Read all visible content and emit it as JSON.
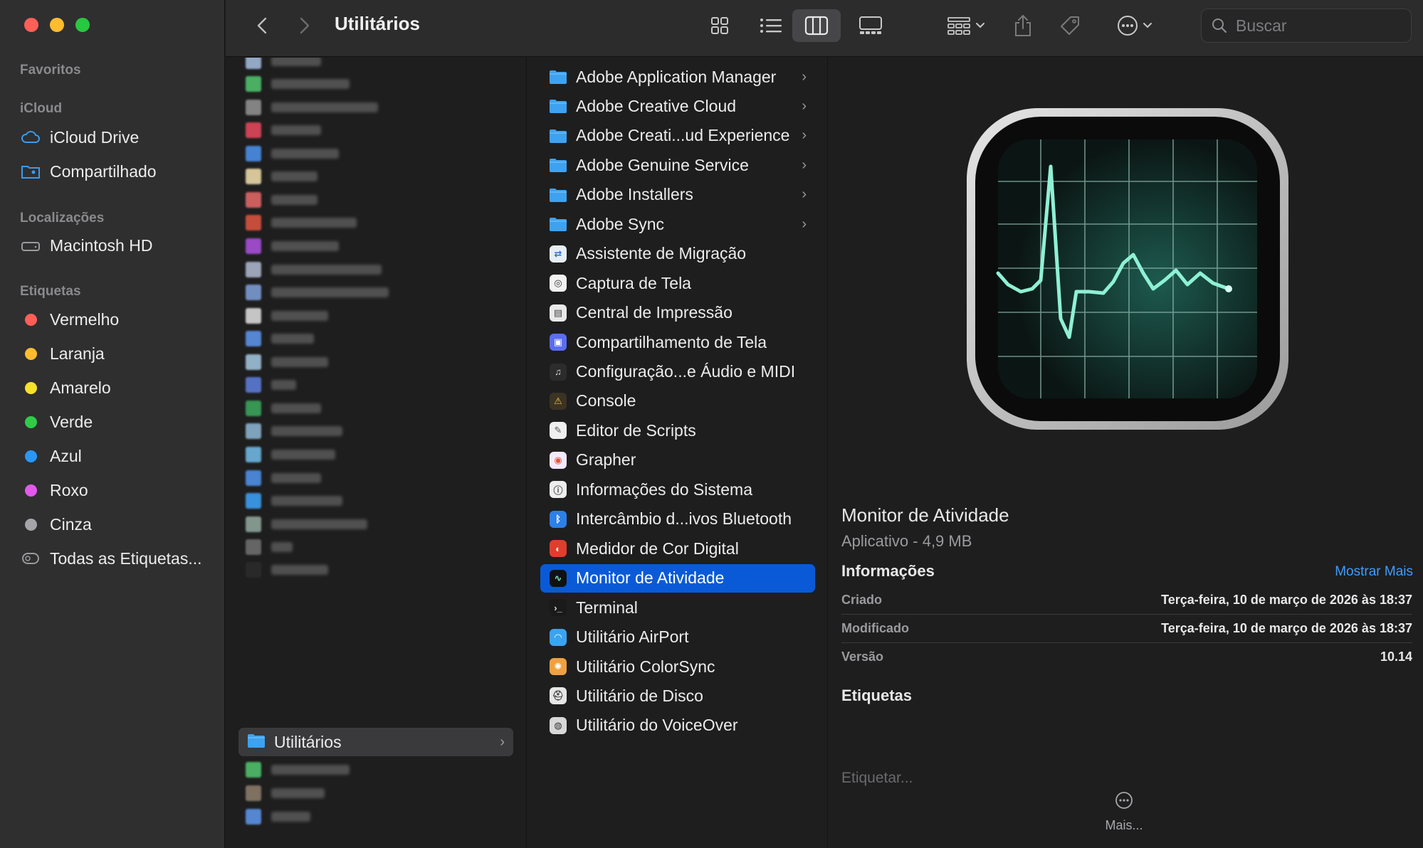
{
  "window": {
    "title": "Utilitários"
  },
  "sidebar": {
    "favorites_label": "Favoritos",
    "icloud_label": "iCloud",
    "icloud_items": [
      {
        "label": "iCloud Drive",
        "icon": "cloud-icon"
      },
      {
        "label": "Compartilhado",
        "icon": "shared-folder-icon"
      }
    ],
    "locations_label": "Localizações",
    "locations_items": [
      {
        "label": "Macintosh HD",
        "icon": "hard-drive-icon"
      }
    ],
    "tags_label": "Etiquetas",
    "tags": [
      {
        "label": "Vermelho",
        "color": "#ff5f57"
      },
      {
        "label": "Laranja",
        "color": "#febc2e"
      },
      {
        "label": "Amarelo",
        "color": "#f7e12b"
      },
      {
        "label": "Verde",
        "color": "#2ecc48"
      },
      {
        "label": "Azul",
        "color": "#2a97f5"
      },
      {
        "label": "Roxo",
        "color": "#e458ee"
      },
      {
        "label": "Cinza",
        "color": "#a5a5a8"
      }
    ],
    "all_tags_label": "Todas as Etiquetas..."
  },
  "toolbar": {
    "back_icon": "chevron-left-icon",
    "forward_icon": "chevron-right-icon",
    "views": [
      "icon-view",
      "list-view",
      "column-view",
      "gallery-view"
    ],
    "active_view": "column-view",
    "search_placeholder": "Buscar"
  },
  "column1": {
    "selected_folder": "Utilitários"
  },
  "column2": {
    "items": [
      {
        "label": "Adobe Application Manager",
        "icon": "folder-icon",
        "has_children": true
      },
      {
        "label": "Adobe Creative Cloud",
        "icon": "folder-icon",
        "has_children": true
      },
      {
        "label": "Adobe Creati...ud Experience",
        "icon": "folder-icon",
        "has_children": true
      },
      {
        "label": "Adobe Genuine Service",
        "icon": "folder-icon",
        "has_children": true
      },
      {
        "label": "Adobe Installers",
        "icon": "folder-icon",
        "has_children": true
      },
      {
        "label": "Adobe Sync",
        "icon": "folder-icon",
        "has_children": true
      },
      {
        "label": "Assistente de Migração",
        "icon": "migration-assistant-icon"
      },
      {
        "label": "Captura de Tela",
        "icon": "screenshot-icon"
      },
      {
        "label": "Central de Impressão",
        "icon": "print-center-icon"
      },
      {
        "label": "Compartilhamento de Tela",
        "icon": "screen-sharing-icon"
      },
      {
        "label": "Configuração...e Áudio e MIDI",
        "icon": "audio-midi-icon"
      },
      {
        "label": "Console",
        "icon": "console-icon"
      },
      {
        "label": "Editor de Scripts",
        "icon": "script-editor-icon"
      },
      {
        "label": "Grapher",
        "icon": "grapher-icon"
      },
      {
        "label": "Informações do Sistema",
        "icon": "system-information-icon"
      },
      {
        "label": "Intercâmbio d...ivos Bluetooth",
        "icon": "bluetooth-icon"
      },
      {
        "label": "Medidor de Cor Digital",
        "icon": "color-meter-icon"
      },
      {
        "label": "Monitor de Atividade",
        "icon": "activity-monitor-icon",
        "selected": true
      },
      {
        "label": "Terminal",
        "icon": "terminal-icon"
      },
      {
        "label": "Utilitário AirPort",
        "icon": "airport-icon"
      },
      {
        "label": "Utilitário ColorSync",
        "icon": "colorsync-icon"
      },
      {
        "label": "Utilitário de Disco",
        "icon": "disk-utility-icon"
      },
      {
        "label": "Utilitário do VoiceOver",
        "icon": "voiceover-icon"
      }
    ]
  },
  "preview": {
    "icon": "activity-monitor-icon",
    "name": "Monitor de Atividade",
    "kind": "Aplicativo - 4,9 MB",
    "info_label": "Informações",
    "show_more_label": "Mostrar Mais",
    "rows": [
      {
        "key": "Criado",
        "value": "Terça-feira, 10 de março de 2026 às 18:37"
      },
      {
        "key": "Modificado",
        "value": "Terça-feira, 10 de março de 2026 às 18:37"
      },
      {
        "key": "Versão",
        "value": "10.14"
      }
    ],
    "tags_label": "Etiquetas",
    "tags_placeholder": "Etiquetar...",
    "more_label": "Mais..."
  },
  "colors": {
    "selection": "#0a5ad7",
    "link": "#3f9cff",
    "folder": "#3ea2f0"
  }
}
